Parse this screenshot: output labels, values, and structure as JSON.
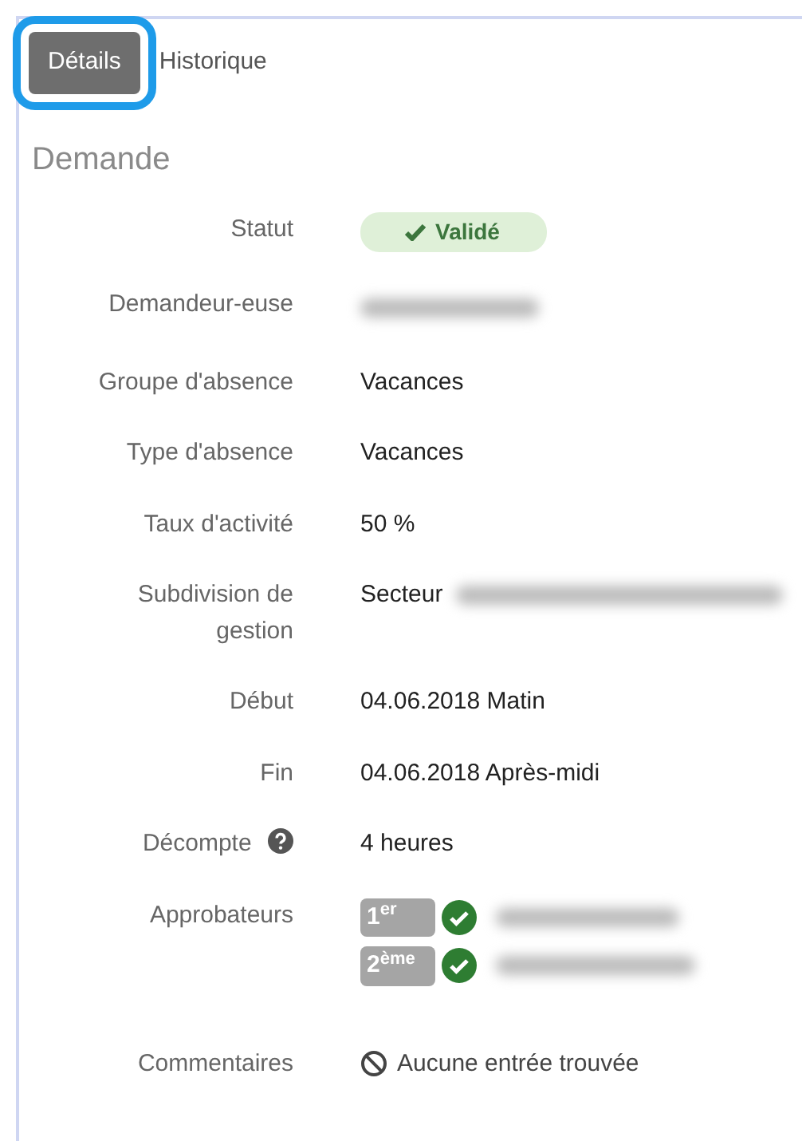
{
  "tabs": [
    {
      "label": "Détails",
      "selected": true,
      "highlighted": true
    },
    {
      "label": "Historique",
      "selected": false,
      "highlighted": false
    }
  ],
  "section": {
    "title": "Demande"
  },
  "fields": [
    {
      "label": "Statut",
      "kind": "status",
      "value": "Validé"
    },
    {
      "label": "Demandeur-euse",
      "kind": "redacted"
    },
    {
      "label": "Groupe d'absence",
      "kind": "text",
      "value": "Vacances"
    },
    {
      "label": "Type d'absence",
      "kind": "text",
      "value": "Vacances"
    },
    {
      "label": "Taux d'activité",
      "kind": "text",
      "value": "50 %"
    },
    {
      "label": "Subdivision de gestion",
      "kind": "partly_redacted",
      "value": "Secteur"
    },
    {
      "label": "Début",
      "kind": "text",
      "value": "04.06.2018 Matin"
    },
    {
      "label": "Fin",
      "kind": "text",
      "value": "04.06.2018 Après-midi"
    },
    {
      "label": "Décompte",
      "kind": "text",
      "value": "4 heures",
      "help": true
    },
    {
      "label": "Approbateurs",
      "kind": "approvers",
      "approvers": [
        {
          "rank": "1$^{er}$",
          "approved": true
        },
        {
          "rank": "2$^{ème}$",
          "approved": true
        }
      ]
    },
    {
      "label": "Commentaires",
      "kind": "empty",
      "value": "Aucune entrée trouvée"
    }
  ]
}
